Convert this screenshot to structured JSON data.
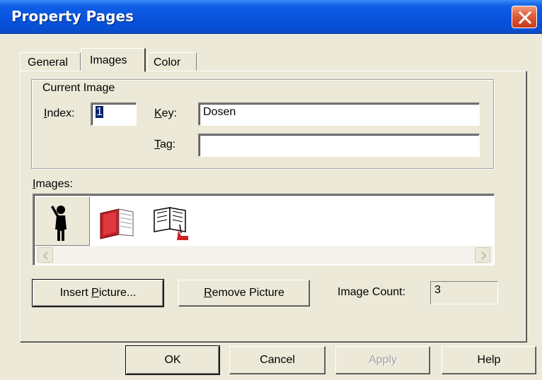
{
  "window": {
    "title": "Property Pages"
  },
  "tabs": [
    {
      "label": "General",
      "selected": false
    },
    {
      "label": "Images",
      "selected": true
    },
    {
      "label": "Color",
      "selected": false
    }
  ],
  "current_image": {
    "group_label": "Current Image",
    "index_label": "Index:",
    "index_value": "1",
    "key_label": "Key:",
    "key_value": "Dosen",
    "tag_label": "Tag:",
    "tag_value": ""
  },
  "images": {
    "label": "Images:",
    "icons": [
      "person-pointing-icon",
      "red-book-icon",
      "open-book-icon"
    ],
    "selected_index": 0
  },
  "actions": {
    "insert_label": "Insert Picture...",
    "remove_label": "Remove Picture",
    "count_label": "Image Count:",
    "count_value": "3"
  },
  "footer": {
    "ok_label": "OK",
    "cancel_label": "Cancel",
    "apply_label": "Apply",
    "help_label": "Help"
  },
  "colors": {
    "titlebar": "#0a55de",
    "dialog_bg": "#ece9d8",
    "selection": "#0a246a",
    "close_button": "#e06040"
  }
}
